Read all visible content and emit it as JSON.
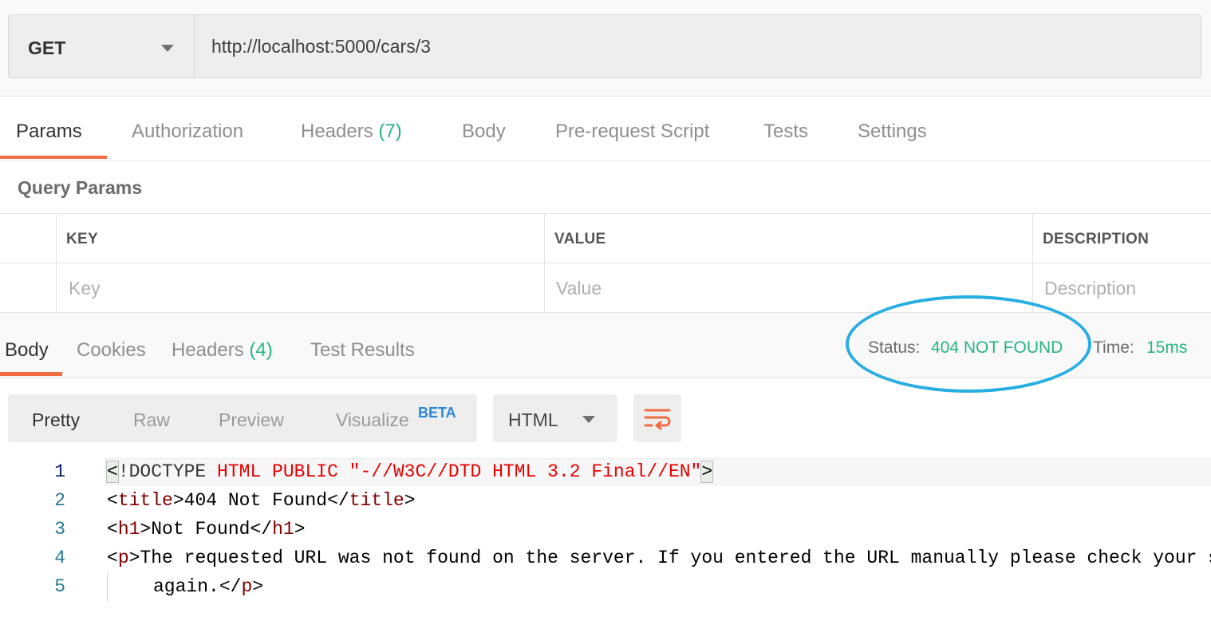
{
  "request": {
    "method": "GET",
    "url": "http://localhost:5000/cars/3"
  },
  "request_tabs": [
    {
      "label": "Params",
      "count": ""
    },
    {
      "label": "Authorization",
      "count": ""
    },
    {
      "label": "Headers",
      "count": "(7)"
    },
    {
      "label": "Body",
      "count": ""
    },
    {
      "label": "Pre-request Script",
      "count": ""
    },
    {
      "label": "Tests",
      "count": ""
    },
    {
      "label": "Settings",
      "count": ""
    }
  ],
  "query_params": {
    "title": "Query Params",
    "columns": [
      "KEY",
      "VALUE",
      "DESCRIPTION"
    ],
    "placeholders": {
      "key": "Key",
      "value": "Value",
      "description": "Description"
    }
  },
  "response_tabs": [
    {
      "label": "Body",
      "count": ""
    },
    {
      "label": "Cookies",
      "count": ""
    },
    {
      "label": "Headers",
      "count": "(4)"
    },
    {
      "label": "Test Results",
      "count": ""
    }
  ],
  "response_meta": {
    "status_label": "Status:",
    "status_value": "404 NOT FOUND",
    "time_label": "Time:",
    "time_value": "15ms"
  },
  "view_options": [
    "Pretty",
    "Raw",
    "Preview",
    "Visualize"
  ],
  "beta_badge": "BETA",
  "language": "HTML",
  "code": {
    "line_numbers": [
      "1",
      "2",
      "3",
      "4",
      "5"
    ],
    "line1": {
      "lt": "<",
      "doctype": "!DOCTYPE ",
      "rest": "HTML PUBLIC \"-//W3C//DTD HTML 3.2 Final//EN\"",
      "gt": ">"
    },
    "line2": {
      "open": "title",
      "text": "404 Not Found",
      "close": "title"
    },
    "line3": {
      "open": "h1",
      "text": "Not Found",
      "close": "h1"
    },
    "line4": {
      "open": "p",
      "text": "The requested URL was not found on the server. If you entered the URL manually please check your spelling and try"
    },
    "line5": {
      "text": "again.",
      "close": "p"
    }
  },
  "colors": {
    "accent": "#f06d44",
    "success": "#26b47f",
    "highlight_ring": "#27aee3",
    "beta": "#2a88d8"
  },
  "icons": [
    "chevron-down-icon",
    "wrap-lines-icon"
  ]
}
